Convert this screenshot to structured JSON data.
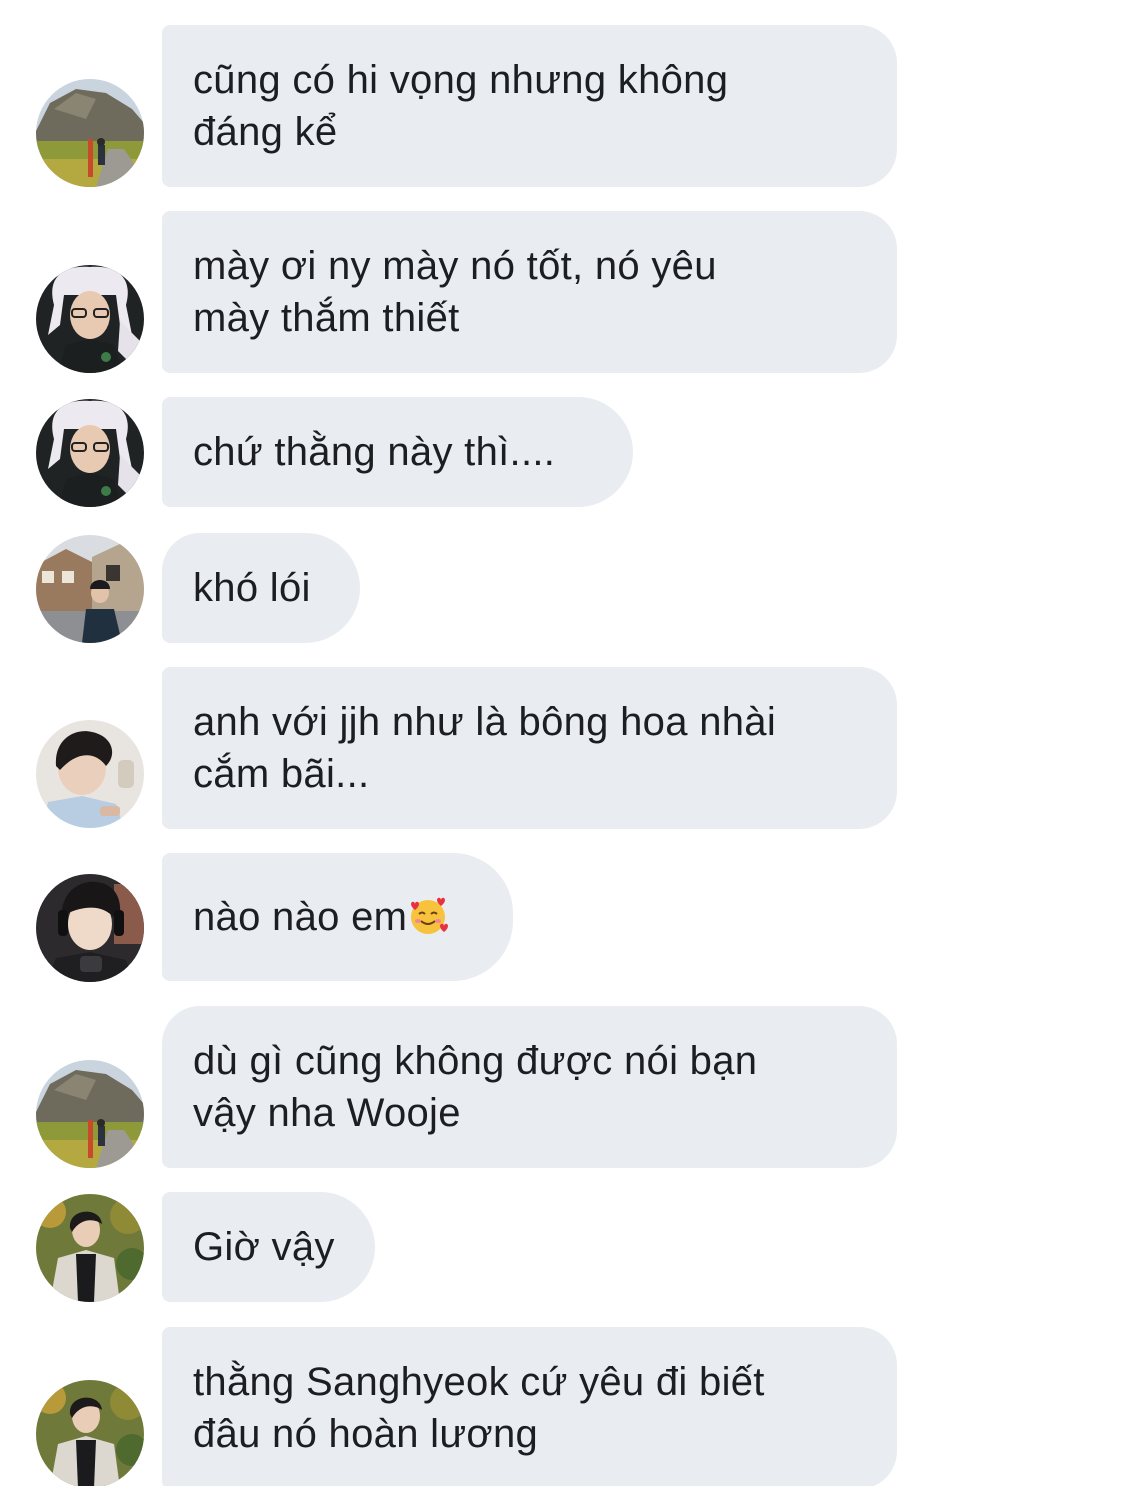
{
  "messages": [
    {
      "text": "cũng có hi vọng nhưng không\nđáng kể",
      "avatar": "landscape-mountain"
    },
    {
      "text": "mày ơi ny mày nó tốt, nó yêu\nmày thắm thiết",
      "avatar": "boy-glasses-bunny-hat"
    },
    {
      "text": "chứ thằng này thì....",
      "avatar": "boy-glasses-bunny-hat"
    },
    {
      "text": "khó lói",
      "avatar": "street-houses"
    },
    {
      "text": "anh với jjh như là bông hoa nhài\ncắm bãi...",
      "avatar": "boy-light-background"
    },
    {
      "text": "nào nào em",
      "emoji": "smiling-face-with-hearts",
      "avatar": "boy-headphones"
    },
    {
      "text": "dù gì cũng không được nói bạn\nvậy nha Wooje",
      "avatar": "landscape-mountain"
    },
    {
      "text": "Giờ vậy",
      "avatar": "boy-autumn-trees"
    },
    {
      "text": "thằng Sanghyeok cứ yêu đi biết\nđâu nó hoàn lương",
      "avatar": "boy-autumn-trees"
    }
  ],
  "colors": {
    "bubble_bg": "#e9ecf0",
    "text": "#1c1e21",
    "page_bg": "#ffffff"
  }
}
